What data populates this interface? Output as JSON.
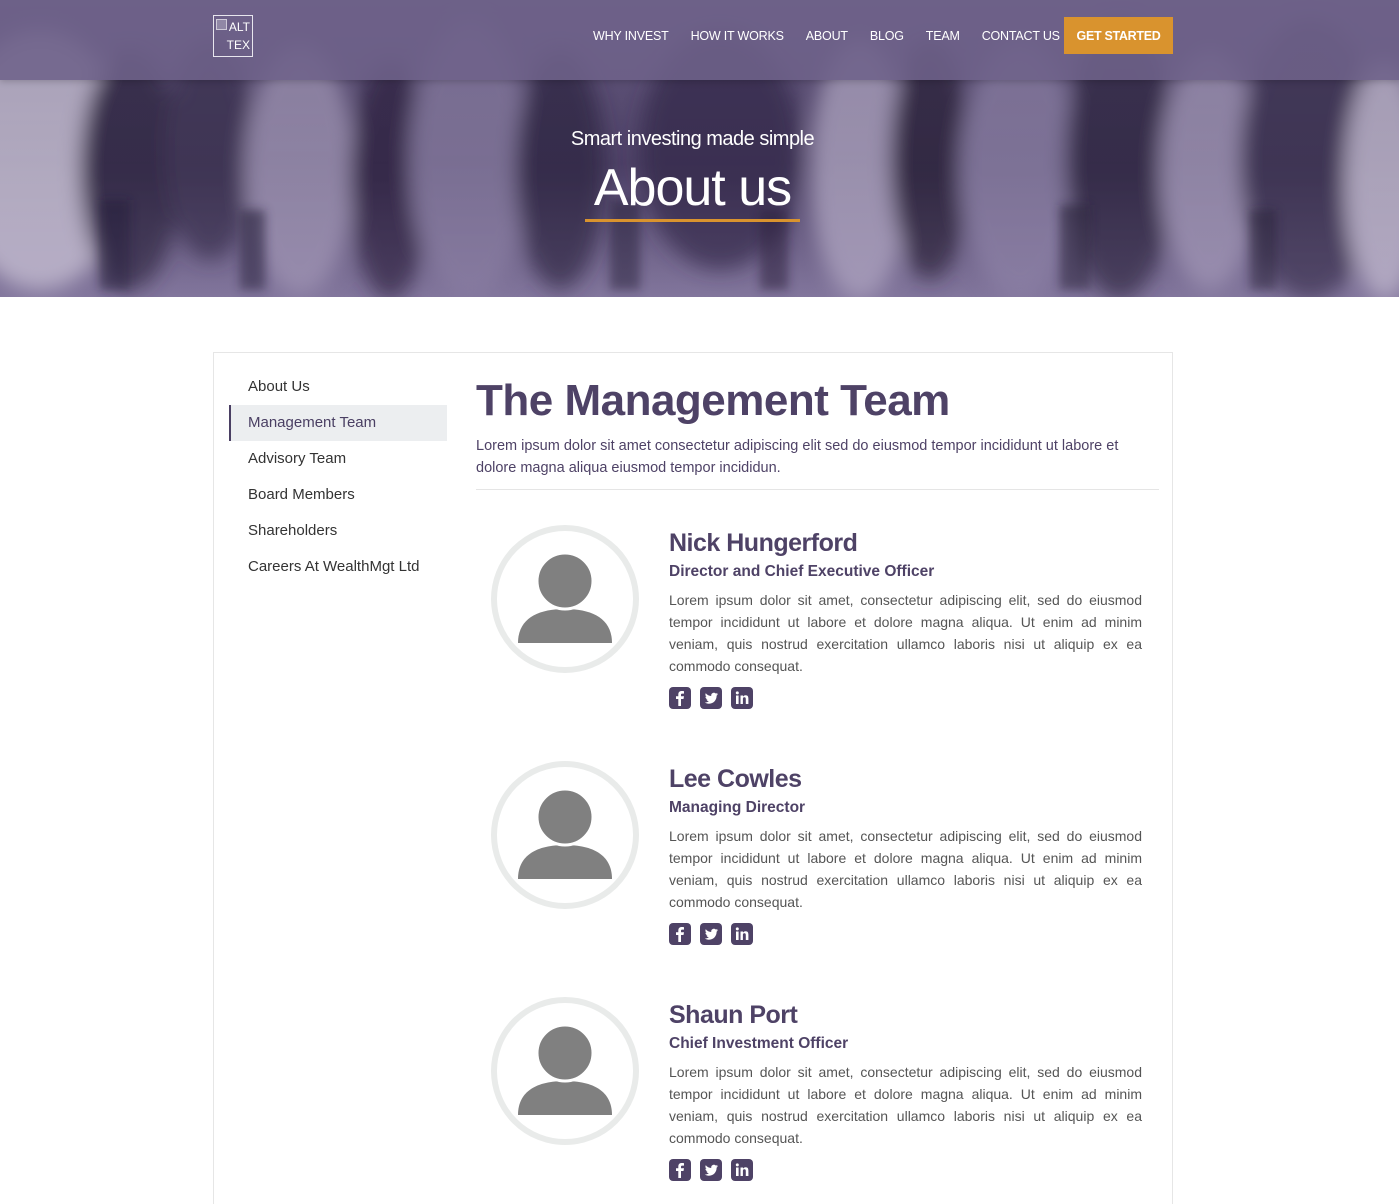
{
  "nav": {
    "logo_alt": "ALT TEX",
    "links": [
      "WHY INVEST",
      "HOW IT WORKS",
      "ABOUT",
      "BLOG",
      "TEAM",
      "CONTACT US"
    ],
    "cta": "GET STARTED"
  },
  "hero": {
    "subtitle": "Smart investing made simple",
    "title": "About us"
  },
  "sidebar": {
    "items": [
      {
        "label": "About Us"
      },
      {
        "label": "Management Team",
        "active": true
      },
      {
        "label": "Advisory Team"
      },
      {
        "label": "Board Members"
      },
      {
        "label": "Shareholders"
      },
      {
        "label": "Careers At WealthMgt Ltd"
      }
    ]
  },
  "main": {
    "title": "The Management Team",
    "intro": "Lorem ipsum dolor sit amet consectetur adipiscing elit sed do eiusmod tempor incididunt ut labore et dolore magna aliqua eiusmod tempor incididun.",
    "members": [
      {
        "name": "Nick Hungerford",
        "role": "Director and Chief Executive Officer",
        "bio": "Lorem ipsum dolor sit amet, consectetur adipiscing elit, sed do eiusmod tempor incididunt ut labore et dolore magna aliqua. Ut enim ad minim veniam, quis nostrud exercitation ullamco laboris nisi ut aliquip ex ea commodo consequat."
      },
      {
        "name": "Lee Cowles",
        "role": "Managing Director",
        "bio": "Lorem ipsum dolor sit amet, consectetur adipiscing elit, sed do eiusmod tempor incididunt ut labore et dolore magna aliqua. Ut enim ad minim veniam, quis nostrud exercitation ullamco laboris nisi ut aliquip ex ea commodo consequat."
      },
      {
        "name": "Shaun Port",
        "role": "Chief Investment Officer",
        "bio": "Lorem ipsum dolor sit amet, consectetur adipiscing elit, sed do eiusmod tempor incididunt ut labore et dolore magna aliqua. Ut enim ad minim veniam, quis nostrud exercitation ullamco laboris nisi ut aliquip ex ea commodo consequat."
      }
    ],
    "social_icons": [
      "facebook-icon",
      "twitter-icon",
      "linkedin-icon"
    ]
  },
  "colors": {
    "brand_purple": "#4e4266",
    "nav_bg": "#6e628a",
    "accent_orange": "#d9932e",
    "avatar_ring": "#e9ebea",
    "avatar_fill": "#808080"
  }
}
